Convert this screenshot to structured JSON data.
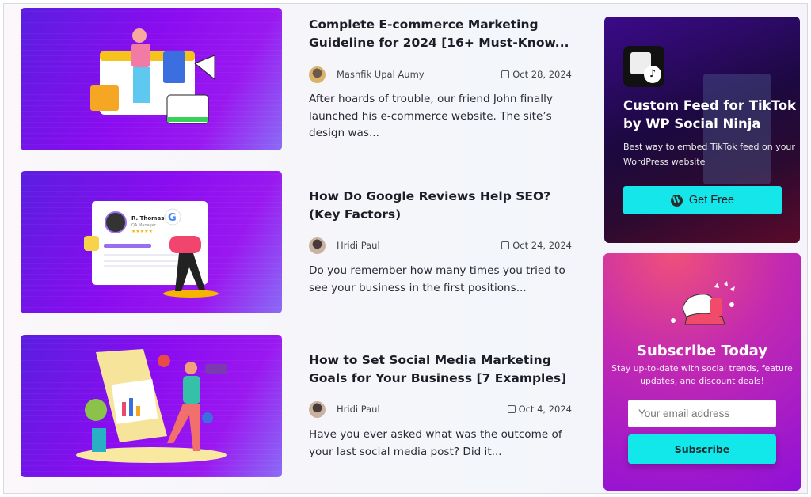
{
  "posts": [
    {
      "title": "Complete E-commerce Marketing Guideline for 2024 [16+ Must-Know...",
      "author": "Mashfik Upal Aumy",
      "date": "Oct 28, 2024",
      "excerpt": "After hoards of trouble, our friend John finally launched his e-commerce website. The site’s design was..."
    },
    {
      "title": "How Do Google Reviews Help SEO? (Key Factors)",
      "author": "Hridi Paul",
      "date": "Oct 24, 2024",
      "excerpt": "Do you remember how many times you tried to see your business in the first positions...",
      "image_text": {
        "name": "R. Thomas",
        "role": "QA Manager"
      }
    },
    {
      "title": "How to Set Social Media Marketing Goals for Your Business [7 Examples]",
      "author": "Hridi Paul",
      "date": "Oct 4, 2024",
      "excerpt": "Have you ever asked what was the outcome of your last social media post? Did it..."
    }
  ],
  "promo": {
    "title": "Custom Feed for TikTok by WP Social Ninja",
    "subtitle": "Best way to embed TikTok feed on your WordPress website",
    "button": "Get Free",
    "accent": "#14e6ea"
  },
  "subscribe": {
    "title": "Subscribe Today",
    "subtitle": "Stay up-to-date with social trends, feature updates, and discount deals!",
    "email_placeholder": "Your email address",
    "button": "Subscribe"
  }
}
